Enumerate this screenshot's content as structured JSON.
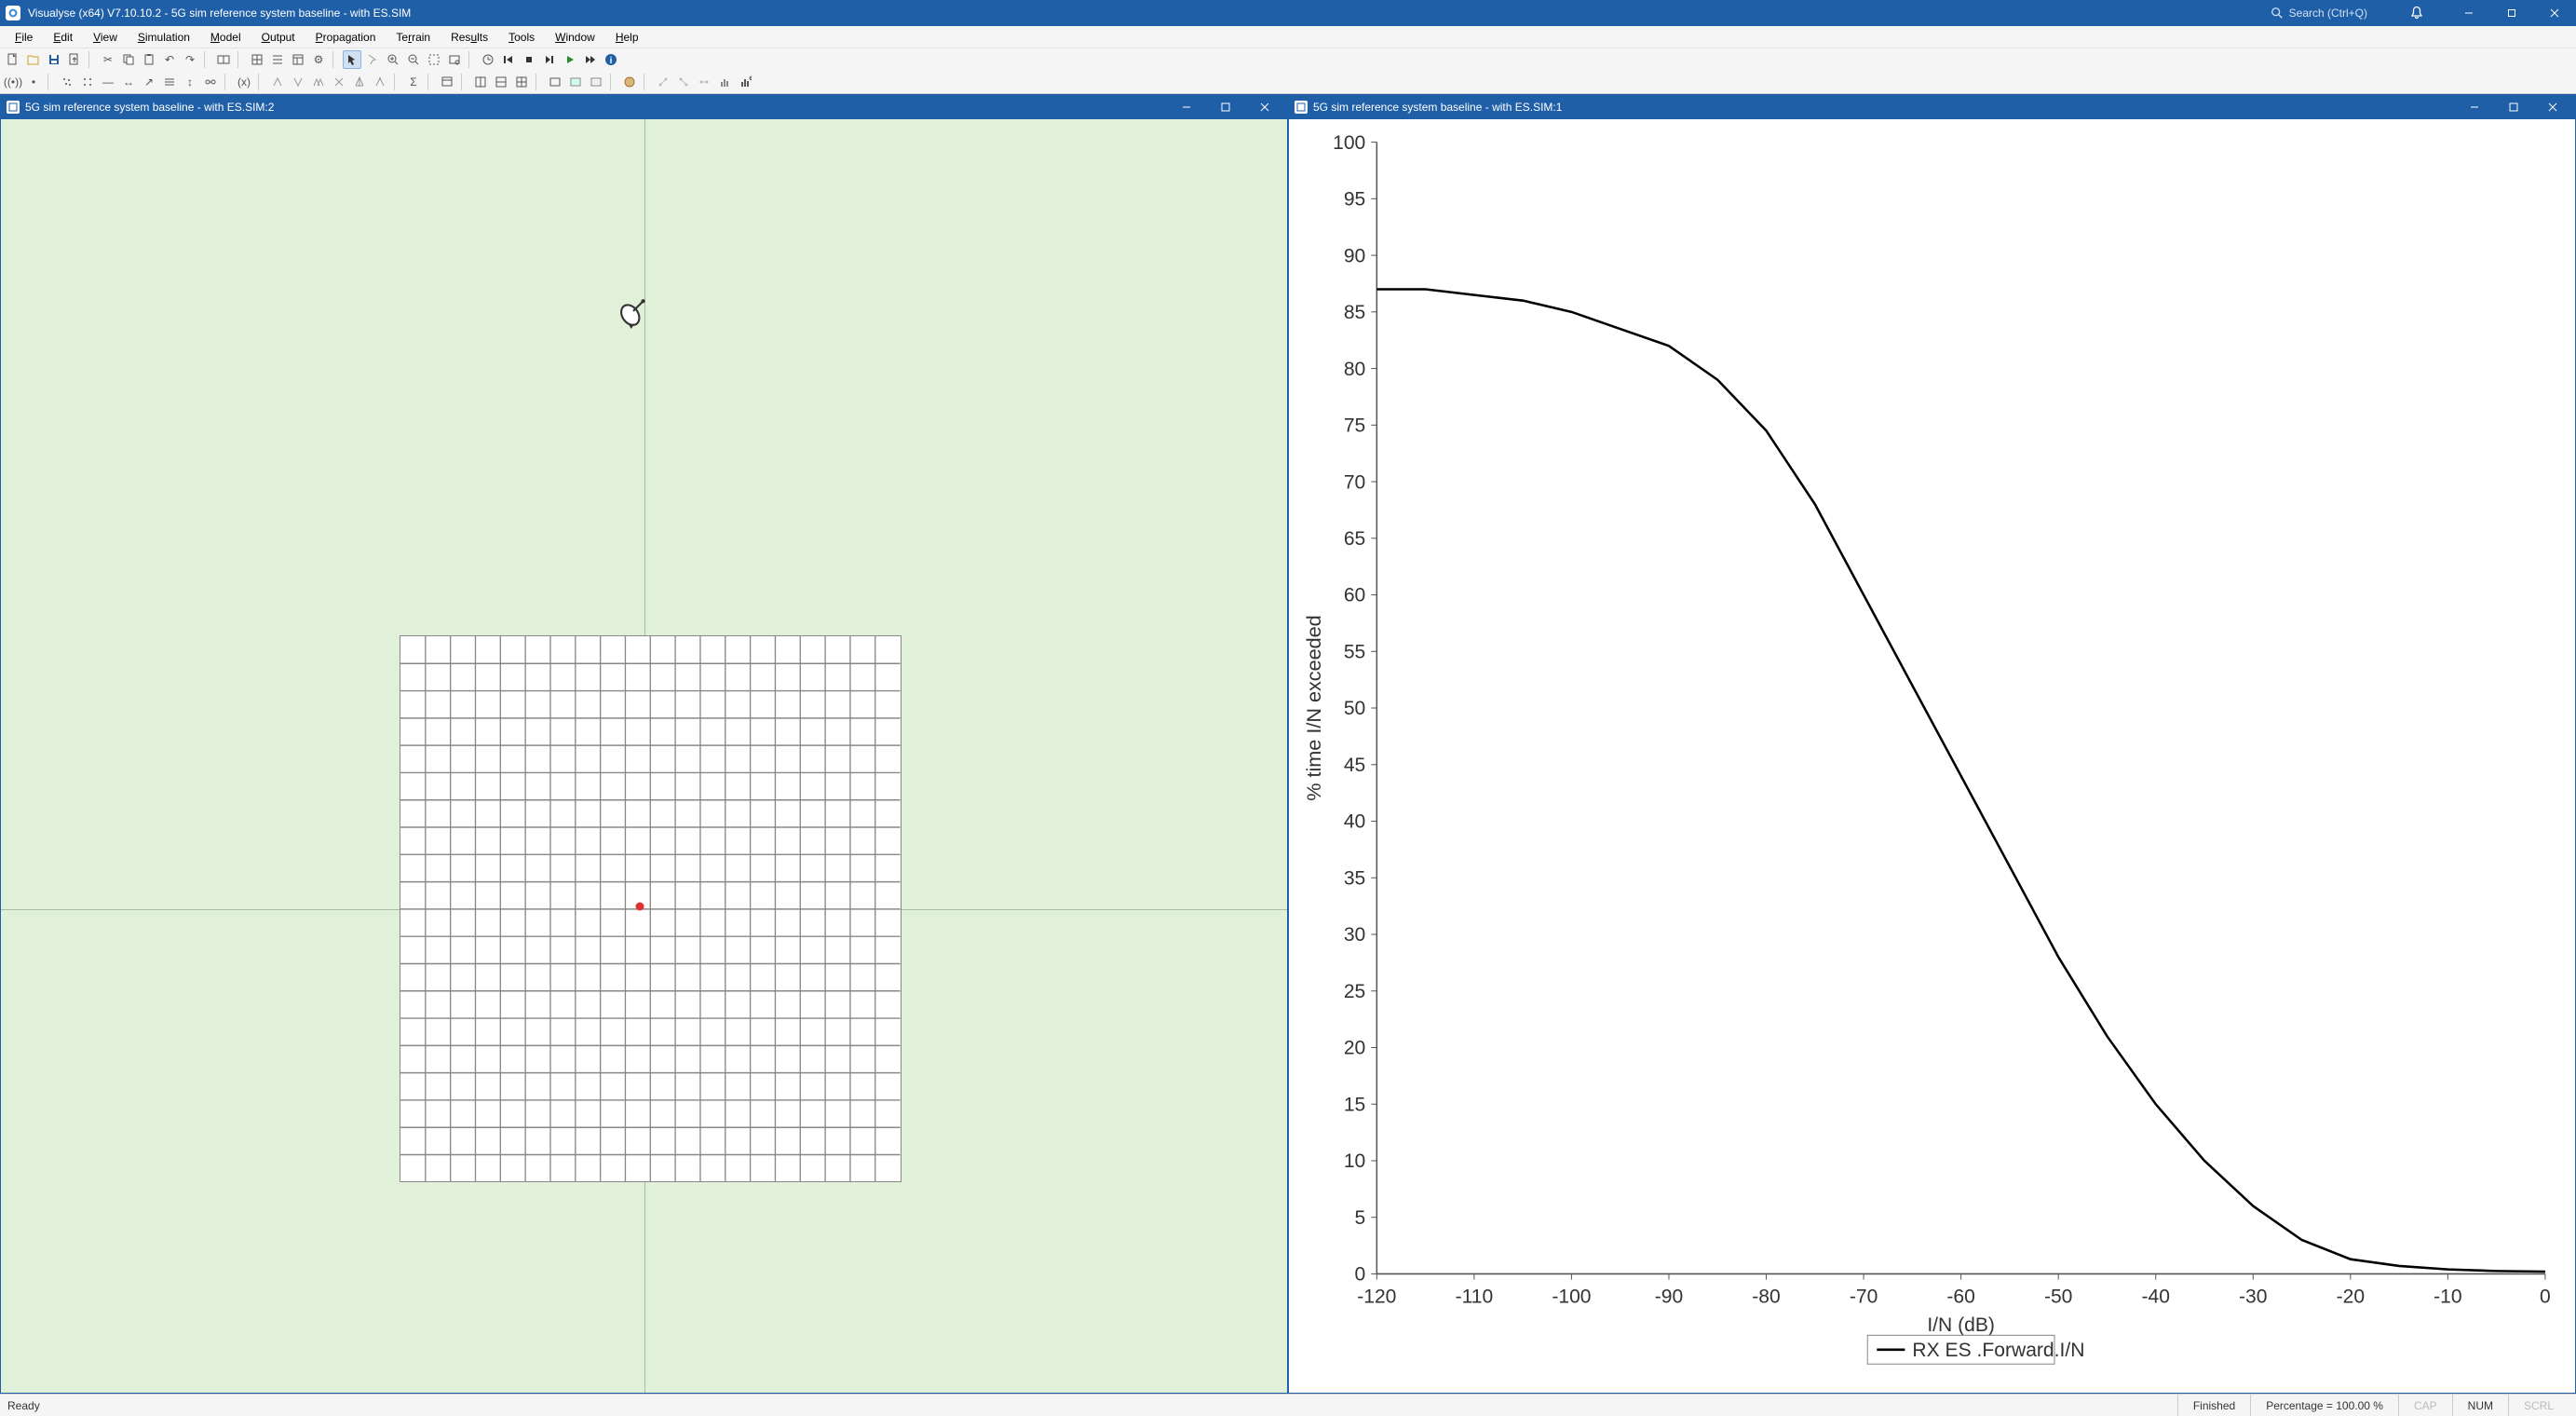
{
  "app": {
    "title": "Visualyse (x64) V7.10.10.2 - 5G sim reference system baseline - with ES.SIM",
    "search_placeholder": "Search (Ctrl+Q)"
  },
  "menus": {
    "file": "File",
    "edit": "Edit",
    "view": "View",
    "simulation": "Simulation",
    "model": "Model",
    "output": "Output",
    "propagation": "Propagation",
    "terrain": "Terrain",
    "results": "Results",
    "tools": "Tools",
    "window": "Window",
    "help": "Help"
  },
  "child_windows": {
    "left": {
      "title": "5G sim reference system baseline - with ES.SIM:2"
    },
    "right": {
      "title": "5G sim reference system baseline - with ES.SIM:1"
    }
  },
  "statusbar": {
    "ready": "Ready",
    "finished": "Finished",
    "percentage": "Percentage =  100.00 %",
    "caps": "CAP",
    "num": "NUM",
    "scrl": "SCRL"
  },
  "map": {
    "grid_cells_x": 20,
    "grid_cells_y": 20
  },
  "chart_data": {
    "type": "line",
    "title": "",
    "xlabel": "I/N (dB)",
    "ylabel": "% time I/N exceeded",
    "xlim": [
      -120,
      0
    ],
    "ylim": [
      0,
      100
    ],
    "x_ticks": [
      -120,
      -110,
      -100,
      -90,
      -80,
      -70,
      -60,
      -50,
      -40,
      -30,
      -20,
      -10,
      0
    ],
    "y_ticks": [
      0,
      5,
      10,
      15,
      20,
      25,
      30,
      35,
      40,
      45,
      50,
      55,
      60,
      65,
      70,
      75,
      80,
      85,
      90,
      95,
      100
    ],
    "series": [
      {
        "name": "RX ES .Forward.I/N",
        "x": [
          -120,
          -115,
          -110,
          -105,
          -100,
          -95,
          -90,
          -85,
          -80,
          -75,
          -70,
          -65,
          -60,
          -55,
          -50,
          -45,
          -40,
          -35,
          -30,
          -25,
          -20,
          -15,
          -10,
          -5,
          0
        ],
        "y": [
          87,
          87,
          86.5,
          86,
          85,
          83.5,
          82,
          79,
          74.5,
          68,
          60,
          52,
          44,
          36,
          28,
          21,
          15,
          10,
          6,
          3,
          1.3,
          0.7,
          0.4,
          0.25,
          0.2
        ]
      }
    ],
    "legend": "RX ES .Forward.I/N"
  }
}
